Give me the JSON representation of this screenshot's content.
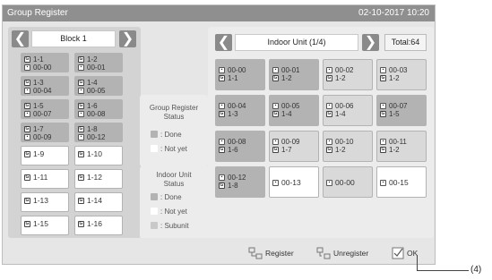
{
  "title": "Group Register",
  "datetime": "02-10-2017   10:20",
  "left_panel": {
    "block_label": "Block 1",
    "cells": [
      {
        "status": "done",
        "group": "1-1",
        "unit": "00-00"
      },
      {
        "status": "done",
        "group": "1-2",
        "unit": "00-01"
      },
      {
        "status": "done",
        "group": "1-3",
        "unit": "00-04"
      },
      {
        "status": "done",
        "group": "1-4",
        "unit": "00-05"
      },
      {
        "status": "done",
        "group": "1-5",
        "unit": "00-07"
      },
      {
        "status": "done",
        "group": "1-6",
        "unit": "00-08"
      },
      {
        "status": "done",
        "group": "1-7",
        "unit": "00-09"
      },
      {
        "status": "done",
        "group": "1-8",
        "unit": "00-12"
      },
      {
        "status": "notyet",
        "group": "1-9"
      },
      {
        "status": "notyet",
        "group": "1-10"
      },
      {
        "status": "notyet",
        "group": "1-11"
      },
      {
        "status": "notyet",
        "group": "1-12"
      },
      {
        "status": "notyet",
        "group": "1-13"
      },
      {
        "status": "notyet",
        "group": "1-14"
      },
      {
        "status": "notyet",
        "group": "1-15"
      },
      {
        "status": "notyet",
        "group": "1-16"
      }
    ]
  },
  "group_status_legend": {
    "title_line1": "Group Register",
    "title_line2": "Status",
    "done": ": Done",
    "not_yet": ": Not yet"
  },
  "indoor_status_legend": {
    "title_line1": "Indoor Unit",
    "title_line2": "Status",
    "done": ": Done",
    "not_yet": ": Not yet",
    "subunit": ": Subunit"
  },
  "right_panel": {
    "page_label": "Indoor Unit (1/4)",
    "total": "Total:64",
    "units": [
      {
        "status": "done",
        "unit": "00-00",
        "group": "1-1"
      },
      {
        "status": "done",
        "unit": "00-01",
        "group": "1-2"
      },
      {
        "status": "sub",
        "unit": "00-02",
        "group": "1-2"
      },
      {
        "status": "sub",
        "unit": "00-03",
        "group": "1-2"
      },
      {
        "status": "done",
        "unit": "00-04",
        "group": "1-3"
      },
      {
        "status": "done",
        "unit": "00-05",
        "group": "1-4"
      },
      {
        "status": "sub",
        "unit": "00-06",
        "group": "1-4"
      },
      {
        "status": "done",
        "unit": "00-07",
        "group": "1-5"
      },
      {
        "status": "done",
        "unit": "00-08",
        "group": "1-6"
      },
      {
        "status": "sub",
        "unit": "00-09",
        "group": "1-7"
      },
      {
        "status": "sub",
        "unit": "00-10",
        "group": "1-2"
      },
      {
        "status": "sub",
        "unit": "00-11",
        "group": "1-2"
      },
      {
        "status": "done",
        "unit": "00-12",
        "group": "1-8"
      },
      {
        "status": "notyet",
        "unit": "00-13"
      },
      {
        "status": "sub",
        "unit": "00-00"
      },
      {
        "status": "notyet",
        "unit": "00-15"
      }
    ]
  },
  "buttons": {
    "register": "Register",
    "unregister": "Unregister",
    "ok": "OK"
  },
  "callout": "(4)",
  "colors": {
    "titlebar": "#8f8f8f",
    "done": "#b3b3b3",
    "not_yet": "#ffffff",
    "subunit": "#d9d9d9"
  },
  "icons": {
    "prev": "chevron-left-icon",
    "next": "chevron-right-icon",
    "group": "group-icon",
    "indoor_unit": "indoor-unit-icon",
    "register": "register-icon",
    "unregister": "unregister-icon",
    "ok": "checkmark-icon"
  }
}
